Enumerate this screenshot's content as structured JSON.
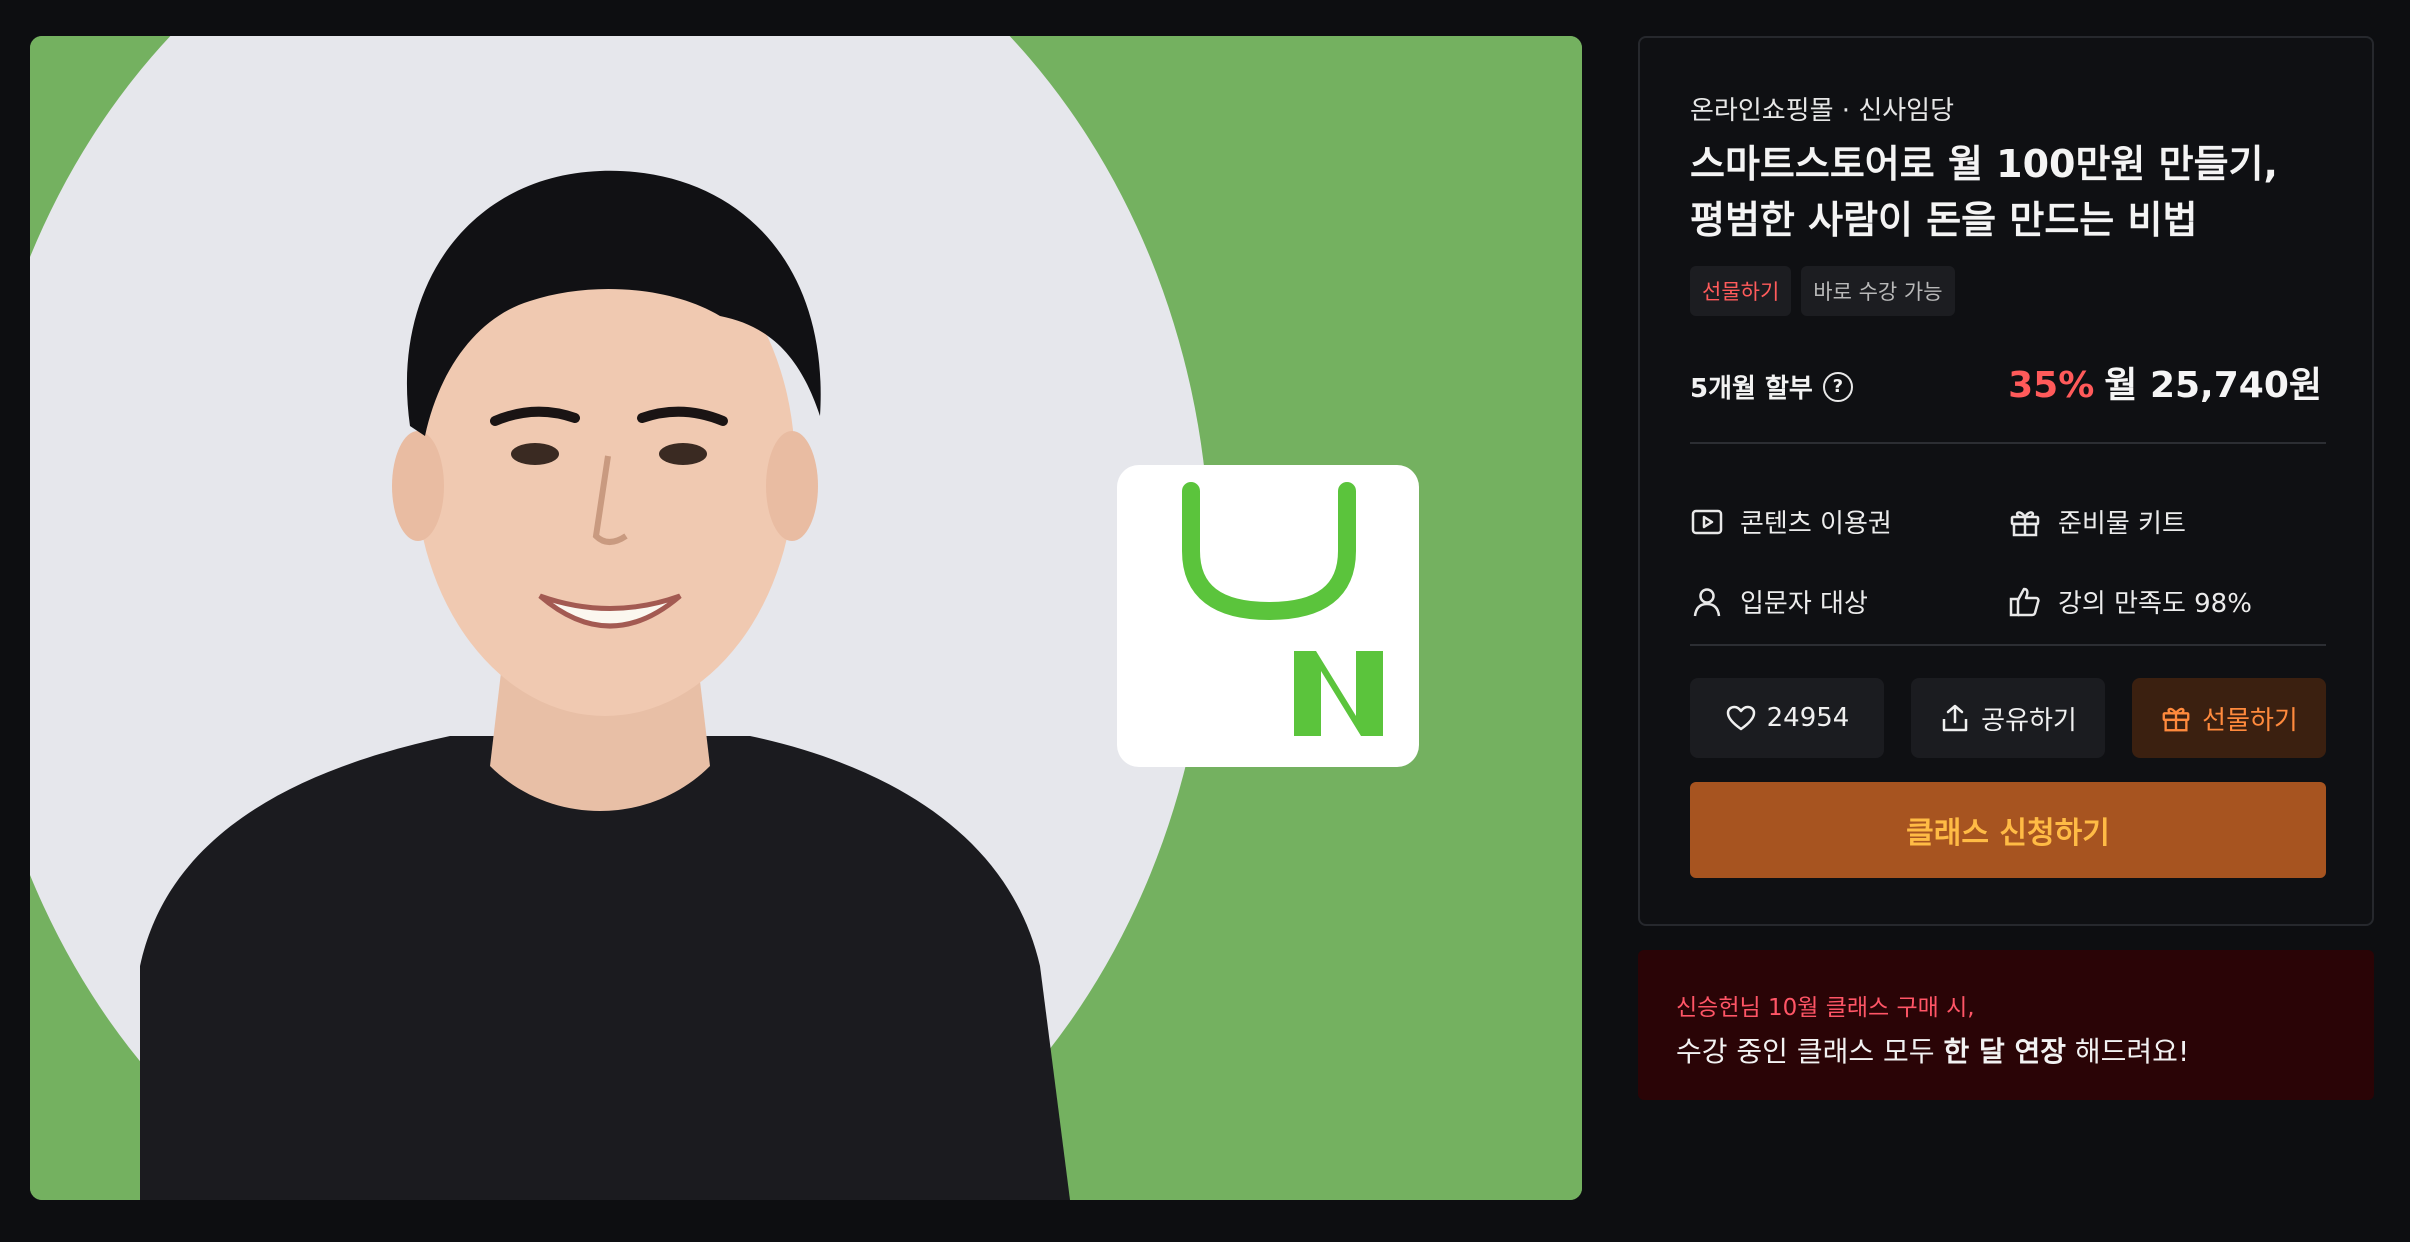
{
  "hero": {
    "logo_icon": "naver-smartstore-bag-icon",
    "bg_color": "#74b160",
    "accent_green": "#5bc43c"
  },
  "course": {
    "category": "온라인쇼핑몰 · 신사임당",
    "title_line1": "스마트스토어로 월 100만원 만들기,",
    "title_line2": "평범한 사람이 돈을 만드는 비법",
    "tags": [
      "선물하기",
      "바로 수강 가능"
    ]
  },
  "pricing": {
    "installment_label": "5개월 할부",
    "help_icon": "?",
    "discount": "35%",
    "monthly_price": "월 25,740원"
  },
  "features": [
    {
      "icon": "play-icon",
      "label": "콘텐츠 이용권"
    },
    {
      "icon": "gift-icon",
      "label": "준비물 키트"
    },
    {
      "icon": "user-icon",
      "label": "입문자 대상"
    },
    {
      "icon": "thumbs-up-icon",
      "label": "강의 만족도 98%"
    }
  ],
  "actions": {
    "like_count": "24954",
    "share_label": "공유하기",
    "gift_label": "선물하기",
    "cta_label": "클래스 신청하기"
  },
  "promo": {
    "line1": "신승헌님 10월 클래스 구매 시,",
    "line2_prefix": "수강 중인 클래스 모두 ",
    "line2_bold": "한 달 연장",
    "line2_suffix": " 해드려요!"
  },
  "colors": {
    "accent_red": "#ff5a5a",
    "cta_bg": "#a75420",
    "cta_text": "#ffbb45",
    "promo_bg": "#2a0406"
  }
}
